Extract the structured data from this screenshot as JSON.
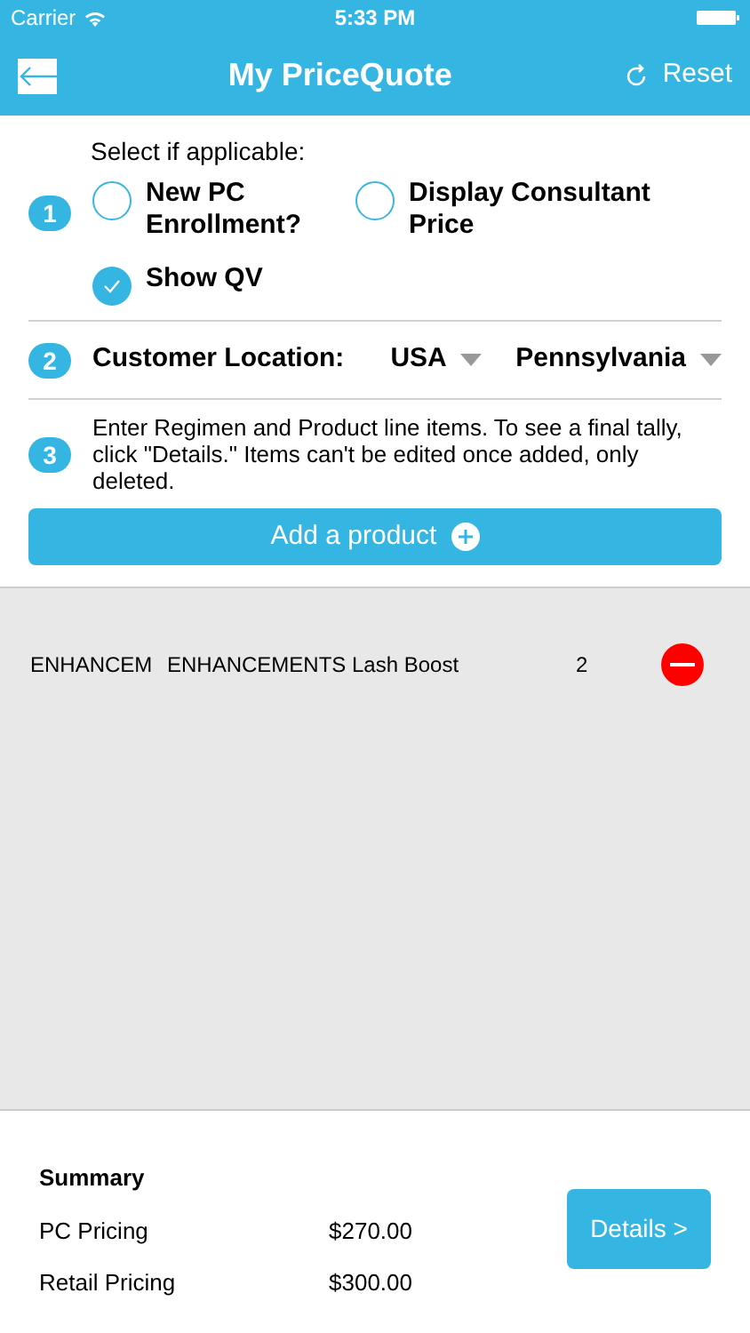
{
  "status_bar": {
    "carrier": "Carrier",
    "time": "5:33 PM"
  },
  "nav": {
    "title": "My PriceQuote",
    "reset": "Reset"
  },
  "steps": [
    {
      "number": "1",
      "kind": "options",
      "heading": "Select if applicable:",
      "options": [
        {
          "label": "New PC Enrollment?",
          "checked": false
        },
        {
          "label": "Display Consultant Price",
          "checked": false
        },
        {
          "label": "Show QV",
          "checked": true
        }
      ]
    },
    {
      "number": "2",
      "kind": "location",
      "label": "Customer Location:",
      "country": "USA",
      "state": "Pennsylvania"
    },
    {
      "number": "3",
      "kind": "text",
      "text": "Enter Regimen and Product line items. To see a final tally, click \"Details.\" Items can't be edited once added, only deleted."
    }
  ],
  "add_button": "Add a product",
  "line_items": [
    {
      "column_1": "ENHANCEM",
      "product": "ENHANCEMENTS Lash Boost",
      "quantity": "2"
    }
  ],
  "summary": {
    "title": "Summary",
    "rows": [
      {
        "label": "PC Pricing",
        "value": "$270.00"
      },
      {
        "label": "Retail Pricing",
        "value": "$300.00"
      }
    ],
    "details_button": "Details >"
  }
}
